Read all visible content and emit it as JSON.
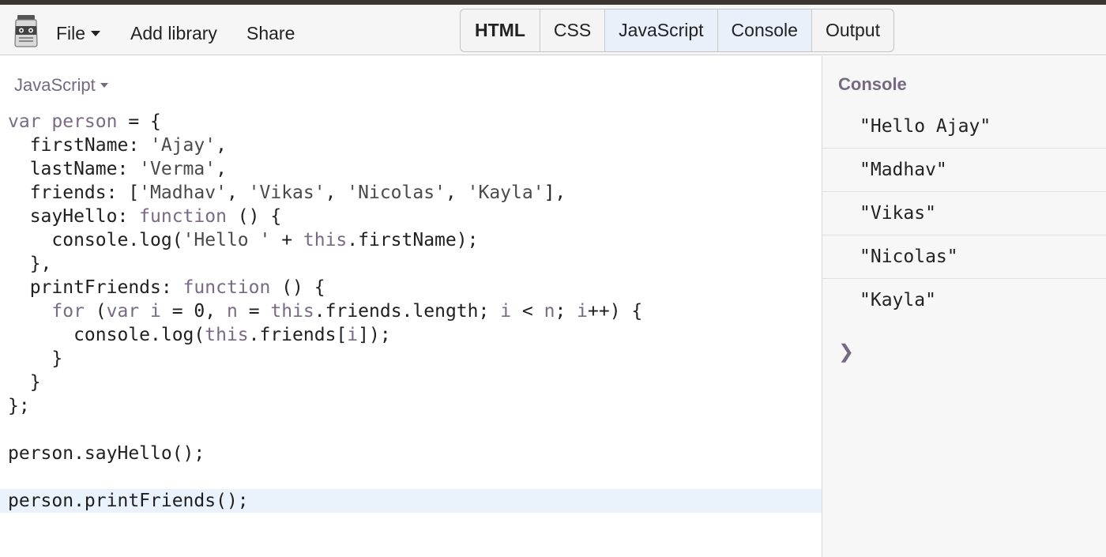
{
  "header": {
    "menu": {
      "file_label": "File",
      "add_library_label": "Add library",
      "share_label": "Share"
    },
    "tabs": [
      {
        "label": "HTML",
        "active": false
      },
      {
        "label": "CSS",
        "active": false
      },
      {
        "label": "JavaScript",
        "active": true
      },
      {
        "label": "Console",
        "active": true
      },
      {
        "label": "Output",
        "active": false
      }
    ]
  },
  "editor": {
    "language": "JavaScript",
    "lines": [
      [
        {
          "t": "var person",
          "c": "kw"
        },
        {
          "t": " = {"
        }
      ],
      [
        {
          "t": "  firstName: "
        },
        {
          "t": "'Ajay'",
          "c": "str"
        },
        {
          "t": ","
        }
      ],
      [
        {
          "t": "  lastName: "
        },
        {
          "t": "'Verma'",
          "c": "str"
        },
        {
          "t": ","
        }
      ],
      [
        {
          "t": "  friends: ["
        },
        {
          "t": "'Madhav'",
          "c": "str"
        },
        {
          "t": ", "
        },
        {
          "t": "'Vikas'",
          "c": "str"
        },
        {
          "t": ", "
        },
        {
          "t": "'Nicolas'",
          "c": "str"
        },
        {
          "t": ", "
        },
        {
          "t": "'Kayla'",
          "c": "str"
        },
        {
          "t": "],"
        }
      ],
      [
        {
          "t": "  sayHello: "
        },
        {
          "t": "function",
          "c": "kw"
        },
        {
          "t": " () {"
        }
      ],
      [
        {
          "t": "    console.log("
        },
        {
          "t": "'Hello '",
          "c": "str"
        },
        {
          "t": " + "
        },
        {
          "t": "this",
          "c": "kw"
        },
        {
          "t": ".firstName);"
        }
      ],
      [
        {
          "t": "  },"
        }
      ],
      [
        {
          "t": "  printFriends: "
        },
        {
          "t": "function",
          "c": "kw"
        },
        {
          "t": " () {"
        }
      ],
      [
        {
          "t": "    "
        },
        {
          "t": "for",
          "c": "kw"
        },
        {
          "t": " ("
        },
        {
          "t": "var i",
          "c": "kw"
        },
        {
          "t": " = 0, "
        },
        {
          "t": "n",
          "c": "kw"
        },
        {
          "t": " = "
        },
        {
          "t": "this",
          "c": "kw"
        },
        {
          "t": ".friends.length; "
        },
        {
          "t": "i",
          "c": "kw"
        },
        {
          "t": " < "
        },
        {
          "t": "n",
          "c": "kw"
        },
        {
          "t": "; "
        },
        {
          "t": "i",
          "c": "kw"
        },
        {
          "t": "++) {"
        }
      ],
      [
        {
          "t": "      console.log("
        },
        {
          "t": "this",
          "c": "kw"
        },
        {
          "t": ".friends["
        },
        {
          "t": "i",
          "c": "kw"
        },
        {
          "t": "]);"
        }
      ],
      [
        {
          "t": "    }"
        }
      ],
      [
        {
          "t": "  }"
        }
      ],
      [
        {
          "t": "};"
        }
      ],
      [
        {
          "t": ""
        }
      ],
      [
        {
          "t": "person.sayHello();"
        }
      ],
      [
        {
          "t": ""
        }
      ],
      [
        {
          "t": "person.printFriends();",
          "active": true
        }
      ]
    ]
  },
  "console": {
    "title": "Console",
    "entries": [
      "\"Hello Ajay\"",
      "\"Madhav\"",
      "\"Vikas\"",
      "\"Nicolas\"",
      "\"Kayla\""
    ],
    "prompt_symbol": "❯"
  },
  "colors": {
    "accent": "#756a82",
    "active_tab": "#e9f0fa",
    "active_line": "#eaf2fc"
  },
  "icons": {
    "logo": "jsbin-logo-icon",
    "file_dropdown": "caret-down-icon",
    "language_dropdown": "caret-down-icon",
    "console_prompt": "chevron-right-icon"
  }
}
